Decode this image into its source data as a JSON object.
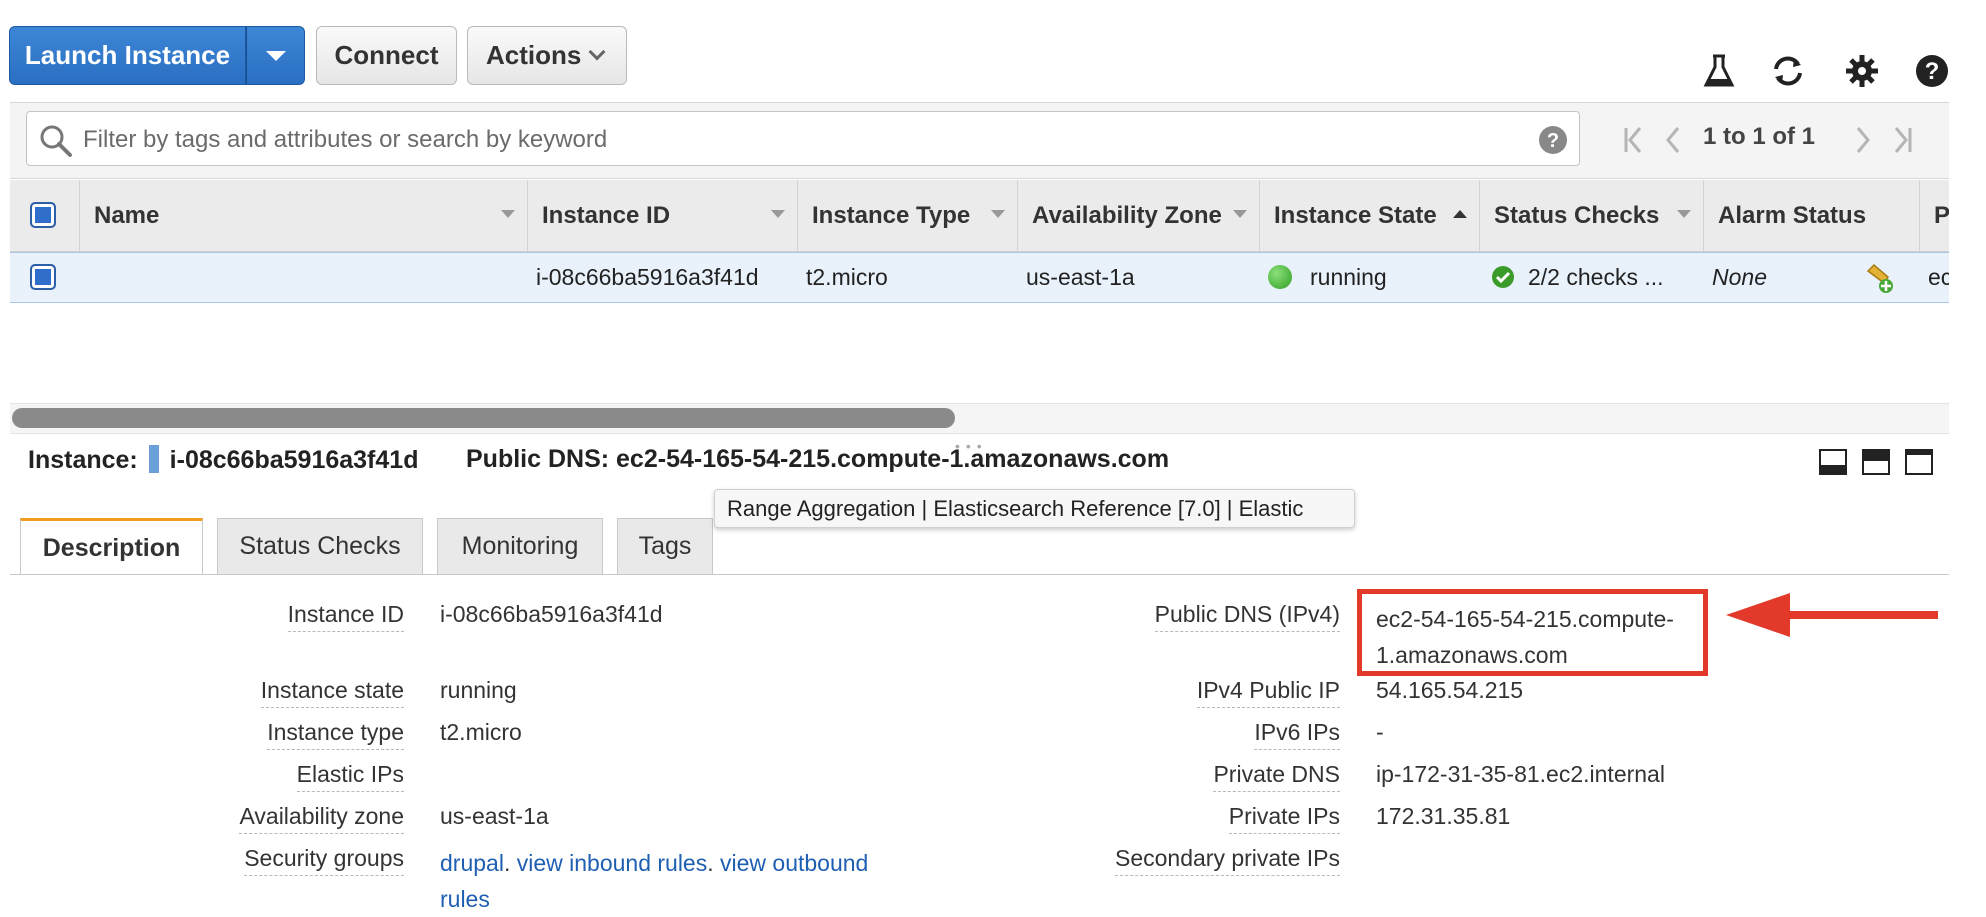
{
  "toolbar": {
    "launch_label": "Launch Instance",
    "connect_label": "Connect",
    "actions_label": "Actions",
    "icons": [
      "flask-icon",
      "refresh-icon",
      "gear-icon",
      "help-icon"
    ]
  },
  "search": {
    "placeholder": "Filter by tags and attributes or search by keyword",
    "value": "",
    "pager_text": "1 to 1 of 1"
  },
  "table": {
    "columns": [
      "Name",
      "Instance ID",
      "Instance Type",
      "Availability Zone",
      "Instance State",
      "Status Checks",
      "Alarm Status",
      "Pu"
    ],
    "rows": [
      {
        "name": "",
        "instance_id": "i-08c66ba5916a3f41d",
        "instance_type": "t2.micro",
        "availability_zone": "us-east-1a",
        "instance_state": "running",
        "status_checks": "2/2 checks ...",
        "alarm_status": "None",
        "public": "ec"
      }
    ]
  },
  "details": {
    "instance_label": "Instance:",
    "instance_id": "i-08c66ba5916a3f41d",
    "public_dns_label": "Public DNS:",
    "public_dns": "ec2-54-165-54-215.compute-1.amazonaws.com",
    "tabs": [
      "Description",
      "Status Checks",
      "Monitoring",
      "Tags"
    ],
    "tooltip": "Range Aggregation | Elasticsearch Reference [7.0] | Elastic",
    "left": [
      {
        "label": "Instance ID",
        "value": "i-08c66ba5916a3f41d"
      },
      {
        "label": "Instance state",
        "value": "running"
      },
      {
        "label": "Instance type",
        "value": "t2.micro"
      },
      {
        "label": "Elastic IPs",
        "value": ""
      },
      {
        "label": "Availability zone",
        "value": "us-east-1a"
      },
      {
        "label": "Security groups",
        "value": ""
      }
    ],
    "security_groups": {
      "group": "drupal",
      "inbound": "view inbound rules",
      "outbound_1": "view outbound",
      "outbound_2": "rules"
    },
    "right": [
      {
        "label": "Public DNS (IPv4)",
        "value_line1": "ec2-54-165-54-215.compute-",
        "value_line2": "1.amazonaws.com"
      },
      {
        "label": "IPv4 Public IP",
        "value": "54.165.54.215"
      },
      {
        "label": "IPv6 IPs",
        "value": "-"
      },
      {
        "label": "Private DNS",
        "value": "ip-172-31-35-81.ec2.internal"
      },
      {
        "label": "Private IPs",
        "value": "172.31.35.81"
      },
      {
        "label": "Secondary private IPs",
        "value": ""
      }
    ]
  },
  "colors": {
    "primary": "#2a6fc2",
    "running_green": "#3bb02e",
    "highlight_red": "#e2392b",
    "link_blue": "#1f5fb2",
    "tab_accent": "#f29b23"
  }
}
